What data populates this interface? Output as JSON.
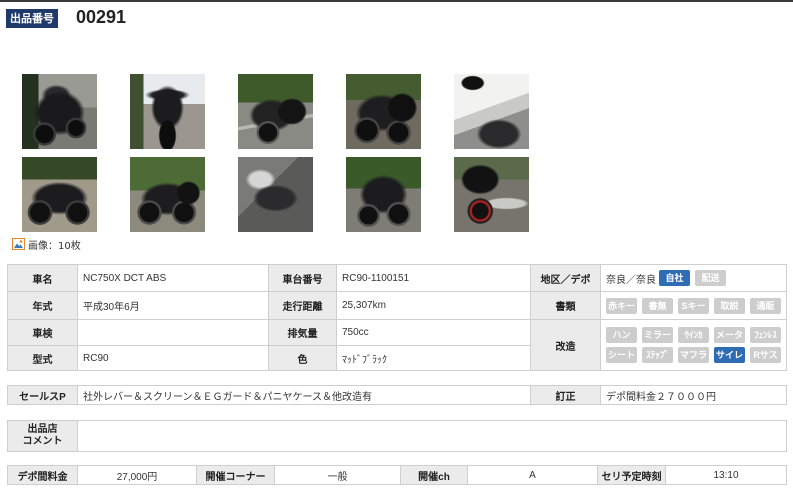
{
  "colors": {
    "header_badge": "#1f3a6a",
    "active_badge": "#2e6db4",
    "inactive_badge": "#cdcdcd",
    "correction_text": "#dd4b39"
  },
  "header": {
    "lot_label": "出品番号",
    "lot_number": "00291"
  },
  "photos": {
    "count_label": "画像：10枚"
  },
  "details": {
    "vehicle_name": {
      "label": "車名",
      "value": "NC750X DCT ABS"
    },
    "frame_number": {
      "label": "車台番号",
      "value": "RC90-1100151"
    },
    "area_depot": {
      "label": "地区／デポ",
      "value": "奈良／奈良",
      "badges": [
        {
          "label": "自社",
          "active": true
        },
        {
          "label": "配送",
          "active": false
        }
      ]
    },
    "model_year": {
      "label": "年式",
      "value": "平成30年6月"
    },
    "mileage": {
      "label": "走行距離",
      "value": "25,307km"
    },
    "documents": {
      "label": "書類",
      "badges": [
        {
          "label": "赤キー",
          "active": false
        },
        {
          "label": "書無",
          "active": false
        },
        {
          "label": "Sキー",
          "active": false
        },
        {
          "label": "取説",
          "active": false
        },
        {
          "label": "通販",
          "active": false
        }
      ]
    },
    "inspection": {
      "label": "車検"
    },
    "displacement": {
      "label": "排気量",
      "value": "750cc"
    },
    "modifications": {
      "label": "改造",
      "badges": [
        {
          "label": "ハン",
          "active": false
        },
        {
          "label": "ミラー",
          "active": false
        },
        {
          "label": "ｳｲﾝｶ",
          "active": false
        },
        {
          "label": "メータ",
          "active": false
        },
        {
          "label": "ﾌｪﾝﾚｽ",
          "active": false
        },
        {
          "label": "シート",
          "active": false
        },
        {
          "label": "ｽﾃｯﾌﾟ",
          "active": false
        },
        {
          "label": "マフラ",
          "active": false
        },
        {
          "label": "サイレ",
          "active": true
        },
        {
          "label": "Rサス",
          "active": false
        }
      ]
    },
    "model_code": {
      "label": "型式",
      "value": "RC90"
    },
    "color": {
      "label": "色",
      "value": "ﾏｯﾄﾞﾌﾞﾗｯｸ"
    }
  },
  "sales_point": {
    "label": "セールスP",
    "value": "社外レバー＆スクリーン＆ＥＧガード＆パニヤケース＆他改造有"
  },
  "correction": {
    "label": "訂正",
    "value": "デポ間料金２７０００円"
  },
  "seller_comment": {
    "label_line1": "出品店",
    "label_line2": "コメント"
  },
  "auction": {
    "depot_fee": {
      "label": "デポ間料金",
      "value": "27,000円"
    },
    "corner": {
      "label": "開催コーナー",
      "value": "一般"
    },
    "channel": {
      "label": "開催ch",
      "value": "A"
    },
    "scheduled_time": {
      "label": "セリ予定時刻",
      "value": "13:10"
    }
  }
}
